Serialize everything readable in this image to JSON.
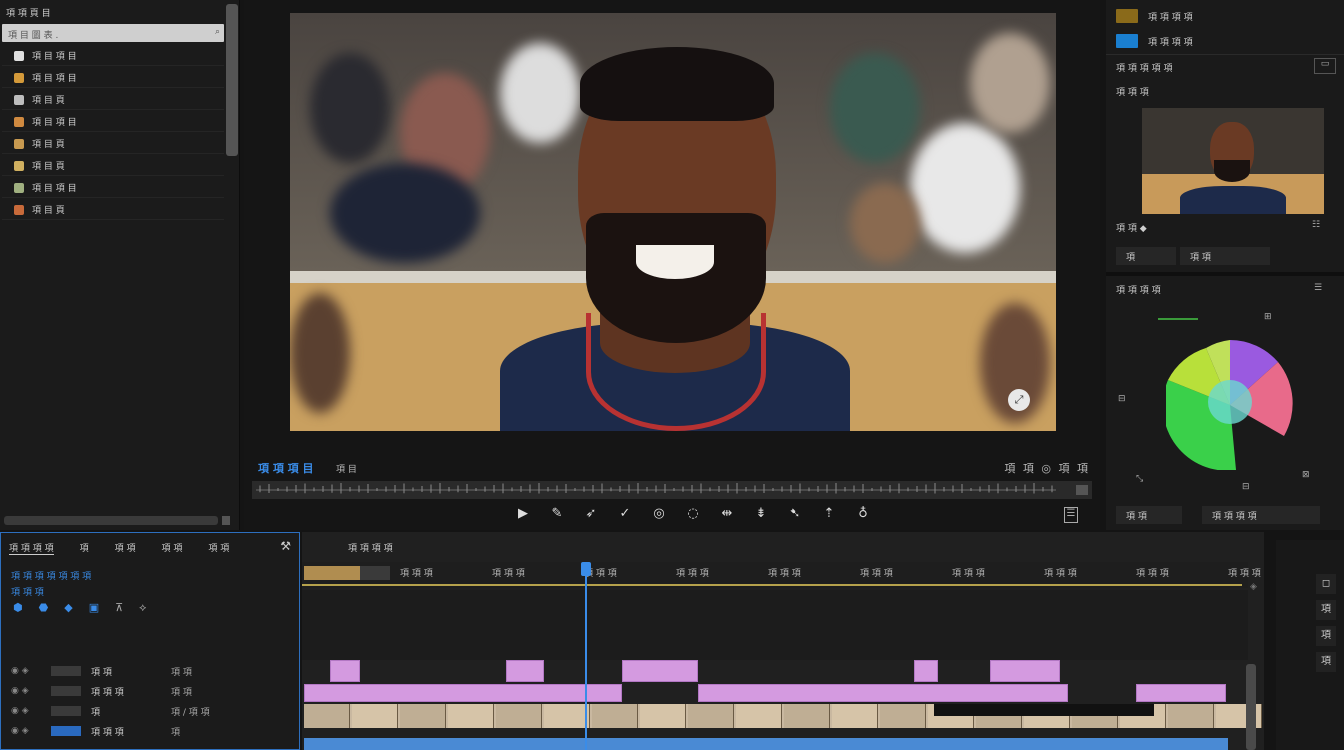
{
  "bin": {
    "header": "項 項 頁 目",
    "search_placeholder": "項 目 圖 表 .",
    "items": [
      {
        "label": "項 目 項 目",
        "icon": "graphic-icon",
        "color": "#e0e0e0"
      },
      {
        "label": "項 目 項 目",
        "icon": "sequence-icon",
        "color": "#d49a3a"
      },
      {
        "label": "項 目 頁",
        "icon": "clip-icon",
        "color": "#bdbdbd"
      },
      {
        "label": "項 目 項 目",
        "icon": "folder-icon",
        "color": "#d08a40"
      },
      {
        "label": "項 目 頁",
        "icon": "audio-icon",
        "color": "#c89a50"
      },
      {
        "label": "項 目 頁",
        "icon": "title-icon",
        "color": "#d0b060"
      },
      {
        "label": "項 目 項 目",
        "icon": "adjustment-icon",
        "color": "#a0b080"
      },
      {
        "label": "項 目 頁",
        "icon": "color-matte-icon",
        "color": "#c86a3a"
      }
    ]
  },
  "viewer": {
    "timecode": "項 項 項 目",
    "sub": "項 目",
    "right_controls": "項 項  ◎ 項 項",
    "transport": [
      "▶",
      "✎",
      "➶",
      "✓",
      "◎",
      "◌",
      "⇹",
      "⇟",
      "➷",
      "⇡",
      "♁"
    ]
  },
  "right_panel": {
    "rows": [
      {
        "label": "項 項 項 項",
        "color": "#8a6a1a"
      },
      {
        "label": "項 項 項 項",
        "color": "#1a7fd0"
      }
    ],
    "toolbar": "項 項 項  項 項",
    "preview_title": "項 項 項",
    "preview_caption": "項 項 ◆",
    "btn_a": "項",
    "btn_b": "項 項",
    "color_title": "項 項 項 項",
    "color_footer_left": "項 項",
    "color_footer_right": "項 項 項 項",
    "wheel_segments": [
      {
        "name": "purple",
        "color": "#9a5ae0"
      },
      {
        "name": "pink",
        "color": "#e86a8a"
      },
      {
        "name": "green",
        "color": "#3ad04a"
      },
      {
        "name": "lime",
        "color": "#b8e03a"
      },
      {
        "name": "cyan",
        "color": "#5ad0d0"
      }
    ]
  },
  "timeline_header": {
    "tabs": [
      "項 項 項 項",
      "項",
      "項 項",
      "項 項",
      "項 項"
    ],
    "timecode": "項 項 項 項 項 項 項",
    "sub_timecode": "項 項 項",
    "tracks": [
      {
        "name": "項 項",
        "sub": "項 項"
      },
      {
        "name": "項 項 項",
        "sub": "項 項"
      },
      {
        "name": "項",
        "sub": "項 / 項 項"
      },
      {
        "name": "項 項 項",
        "sub": "項"
      }
    ]
  },
  "timeline": {
    "sequence_name": "項 項 項 項",
    "ruler_ticks": [
      "項 項 項",
      "項 項 項",
      "項 項 項",
      "項 項 項",
      "項 項 項",
      "項 項 項",
      "項 項 項",
      "項 項 項",
      "項 項 項",
      "項 項 項"
    ],
    "clip_color": "#d49ae0",
    "audio_color": "#4a8ad4",
    "playhead_color": "#3a8ce8"
  },
  "tools": [
    "◻",
    "項",
    "項",
    "項"
  ]
}
